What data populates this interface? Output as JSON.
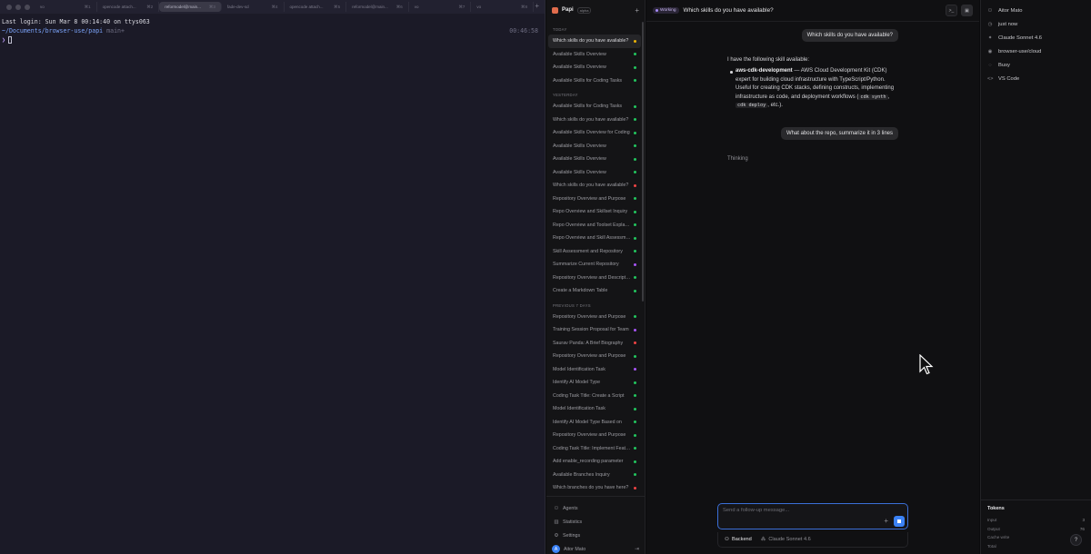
{
  "terminal": {
    "tabs": [
      {
        "label": "vo",
        "num": "⌘1",
        "active": false
      },
      {
        "label": "opencode attach...",
        "num": "⌘2",
        "active": false
      },
      {
        "label": "reformodel@main...",
        "num": "⌘3",
        "active": true
      },
      {
        "label": "fade-dev-sd",
        "num": "⌘4",
        "active": false
      },
      {
        "label": "opencode attach...",
        "num": "⌘5",
        "active": false
      },
      {
        "label": "reformodel@main...",
        "num": "⌘6",
        "active": false
      },
      {
        "label": "vo",
        "num": "⌘7",
        "active": false
      },
      {
        "label": "vo",
        "num": "⌘8",
        "active": false
      }
    ],
    "new_tab": "+",
    "login_line": "Last login: Sun Mar  8 00:14:40 on ttys063",
    "path": "~/Documents/browser-use/papi",
    "branch": " main+",
    "clock": "00:46:58",
    "prompt": "❯"
  },
  "sidebar": {
    "app_name": "Papi",
    "badge": "alpha",
    "new_button": "+",
    "sections": [
      {
        "label": "TODAY",
        "items": [
          {
            "title": "Which skills do you have available?",
            "dot": "#eab308",
            "active": true
          },
          {
            "title": "Available Skills Overview",
            "dot": "#22c55e"
          },
          {
            "title": "Available Skills Overview",
            "dot": "#22c55e"
          },
          {
            "title": "Available Skills for Coding Tasks",
            "dot": "#22c55e"
          }
        ]
      },
      {
        "label": "YESTERDAY",
        "items": [
          {
            "title": "Available Skills for Coding Tasks",
            "dot": "#22c55e"
          },
          {
            "title": "Which skills do you have available?",
            "dot": "#22c55e"
          },
          {
            "title": "Available Skills Overview for Coding",
            "dot": "#22c55e"
          },
          {
            "title": "Available Skills Overview",
            "dot": "#22c55e"
          },
          {
            "title": "Available Skills Overview",
            "dot": "#22c55e"
          },
          {
            "title": "Available Skills Overview",
            "dot": "#22c55e"
          },
          {
            "title": "Which skills do you have available?",
            "dot": "#ef4444"
          },
          {
            "title": "Repository Overview and Purpose",
            "dot": "#22c55e"
          },
          {
            "title": "Repo Overview and Skillset Inquiry",
            "dot": "#22c55e"
          },
          {
            "title": "Repo Overview and Toolset Explanation",
            "dot": "#22c55e"
          },
          {
            "title": "Repo Overview and Skill Assessment",
            "dot": "#22c55e"
          },
          {
            "title": "Skill Assessment and Repository",
            "dot": "#22c55e"
          },
          {
            "title": "Summarize Current Repository",
            "dot": "#a855f7"
          },
          {
            "title": "Repository Overview and Description",
            "dot": "#22c55e"
          },
          {
            "title": "Create a Markdown Table",
            "dot": "#22c55e"
          }
        ]
      },
      {
        "label": "PREVIOUS 7 DAYS",
        "items": [
          {
            "title": "Repository Overview and Purpose",
            "dot": "#22c55e"
          },
          {
            "title": "Training Session Proposal for Team",
            "dot": "#a855f7"
          },
          {
            "title": "Saurav Panda: A Brief Biography",
            "dot": "#ef4444"
          },
          {
            "title": "Repository Overview and Purpose",
            "dot": "#22c55e"
          },
          {
            "title": "Model Identification Task",
            "dot": "#a855f7"
          },
          {
            "title": "Identify AI Model Type",
            "dot": "#22c55e"
          },
          {
            "title": "Coding Task Title: Create a Script",
            "dot": "#22c55e"
          },
          {
            "title": "Model Identification Task",
            "dot": "#22c55e"
          },
          {
            "title": "Identify AI Model Type Based on",
            "dot": "#22c55e"
          },
          {
            "title": "Repository Overview and Purpose",
            "dot": "#22c55e"
          },
          {
            "title": "Coding Task Title: Implement Feature",
            "dot": "#22c55e"
          },
          {
            "title": "Add enable_recording parameter",
            "dot": "#22c55e"
          },
          {
            "title": "Available Branches Inquiry",
            "dot": "#22c55e"
          },
          {
            "title": "Which branches do you have here?",
            "dot": "#ef4444"
          }
        ]
      }
    ],
    "footer": {
      "agents": "Agents",
      "statistics": "Statistics",
      "settings": "Settings",
      "user_initial": "A",
      "user_name": "Aitor Mato"
    }
  },
  "main": {
    "status": "Working",
    "title": "Which skills do you have available?",
    "messages": {
      "user1": "Which skills do you have available?",
      "assistant_intro": "I have the following skill available:",
      "skill_name": "aws-cdk-development",
      "skill_desc_1": " — AWS Cloud Development Kit (CDK) expert for building cloud infrastructure with TypeScript/Python. Useful for creating CDK stacks, defining constructs, implementing infrastructure as code, and deployment workflows (",
      "code1": "cdk synth",
      "sep": ", ",
      "code2": "cdk deploy",
      "skill_desc_2": ", etc.).",
      "user2": "What about the repo, summarize it in 3 lines",
      "thinking": "Thinking"
    },
    "composer": {
      "placeholder": "Send a follow-up message...",
      "plus": "+",
      "backend": "Backend",
      "model": "Claude Sonnet 4.6"
    }
  },
  "right_panel": {
    "user": "Aitor Mato",
    "time": "just now",
    "model": "Claude Sonnet 4.6",
    "repo": "browser-use/cloud",
    "state": "Busy",
    "editor": "VS Code",
    "tokens": {
      "title": "Tokens",
      "rows": [
        {
          "label": "Input",
          "value": "3"
        },
        {
          "label": "Output",
          "value": "76"
        },
        {
          "label": "Cache write",
          "value": ""
        },
        {
          "label": "Total",
          "value": ""
        }
      ]
    },
    "help": "?"
  },
  "colors": {
    "accent": "#3b82f6",
    "working": "#a78bfa",
    "ok": "#22c55e",
    "error": "#ef4444",
    "pending": "#eab308"
  }
}
